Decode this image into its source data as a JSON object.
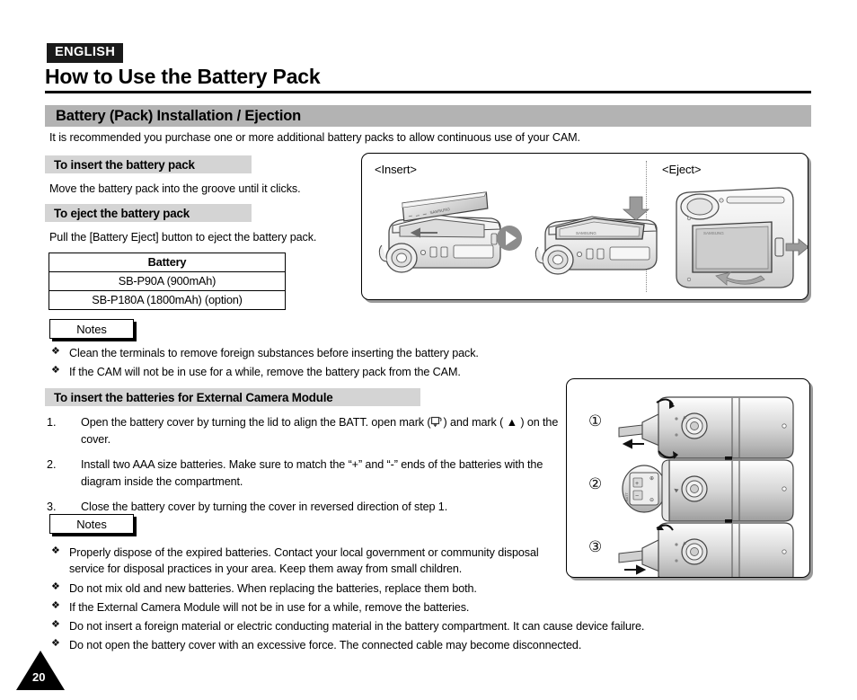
{
  "header": {
    "language_badge": "ENGLISH",
    "title": "How to Use the Battery Pack"
  },
  "section": {
    "heading": "Battery (Pack) Installation / Ejection",
    "intro": "It is recommended you purchase one or more additional battery packs to allow continuous use of your CAM."
  },
  "subsections": {
    "insert_heading": "To insert the battery pack",
    "insert_body": "Move the battery pack into the groove until it clicks.",
    "eject_heading": "To eject the battery pack",
    "eject_body": "Pull the [Battery Eject] button to eject the battery pack.",
    "external_heading": "To insert the batteries for External Camera Module"
  },
  "battery_table": {
    "header": "Battery",
    "rows": [
      "SB-P90A (900mAh)",
      "SB-P180A (1800mAh) (option)"
    ]
  },
  "notes_label_1": "Notes",
  "notes_label_2": "Notes",
  "notes_1": [
    "Clean the terminals to remove foreign substances before inserting the battery pack.",
    "If the CAM will not be in use for a while, remove the battery pack from the CAM."
  ],
  "steps": [
    {
      "num": "1.",
      "text_before": "Open the battery cover by turning the lid to align the BATT. open mark (",
      "text_after": ") and mark ( ▲ ) on the cover."
    },
    {
      "num": "2.",
      "text": "Install two AAA size batteries. Make sure to match the “+” and “-” ends of the batteries with the diagram inside the compartment."
    },
    {
      "num": "3.",
      "text": "Close the battery cover by turning the cover in reversed direction of step 1."
    }
  ],
  "notes_2": [
    "Properly dispose of the expired batteries. Contact your local government or community disposal service for disposal practices in your area. Keep them away from small children.",
    "Do not mix old and new batteries. When replacing the batteries, replace them both.",
    "If the External Camera Module will not be in use for a while, remove the batteries.",
    "Do not insert a foreign material or electric conducting material in the battery compartment. It can cause device failure.",
    "Do not open the battery cover with an excessive force. The connected cable may become disconnected."
  ],
  "bullet_glyph": "❖",
  "illustrations": {
    "top": {
      "caption_insert": "<Insert>",
      "caption_eject": "<Eject>"
    },
    "bottom": {
      "step_labels": [
        "①",
        "②",
        "③"
      ]
    }
  },
  "page_number": "20",
  "colors": {
    "section_bar": "#b3b3b3",
    "sub_bar": "#d4d4d4",
    "badge_bg": "#1a1a1a",
    "rule": "#000000",
    "shadow": "#9a9a9a"
  }
}
